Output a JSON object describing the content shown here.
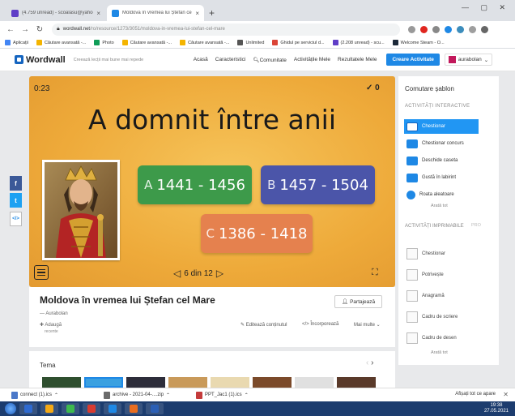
{
  "browser": {
    "tabs": [
      {
        "label": "(4.759 unread) - scoalasu@yahoo",
        "favicon_color": "#5f3ec7"
      },
      {
        "label": "Moldova în vremea lui Ștefan cel",
        "favicon_color": "#1e88e5"
      }
    ],
    "new_tab_glyph": "+",
    "window_controls": "—  ▢  ✕",
    "url_domain": "wordwall.net",
    "url_path": "/ro/resource/1273/3051/moldova-in-vremea-lui-stefan-cel-mare",
    "bookmarks": [
      {
        "label": "Aplicații",
        "color": "#4285f4"
      },
      {
        "label": "Căutare avansată -...",
        "color": "#f4b400"
      },
      {
        "label": "Photo",
        "color": "#0f9d58"
      },
      {
        "label": "Căutare avansată -...",
        "color": "#f4b400"
      },
      {
        "label": "Căutare avansată -...",
        "color": "#f4b400"
      },
      {
        "label": "Unlimited",
        "color": "#555555"
      },
      {
        "label": "Ghidul pe serviciul d...",
        "color": "#db4437"
      },
      {
        "label": "(2.208 unread) - scu...",
        "color": "#5f3ec7"
      },
      {
        "label": "Welcome Steam - O...",
        "color": "#1b2838"
      }
    ]
  },
  "header": {
    "logo": "Wordwall",
    "slogan": "Creează lecții mai bune mai repede",
    "nav": [
      "Acasă",
      "Caracteristici",
      "Comunitate",
      "Activitățile Mele",
      "Rezultatele Mele"
    ],
    "create_button": "Creare Activitate",
    "user": "aurabolan"
  },
  "game": {
    "timer": "0:23",
    "score": "0",
    "score_glyph": "✓",
    "question": "A domnit între anii",
    "answers": [
      {
        "letter": "A",
        "text": "1441 - 1456",
        "color": "#3d9a4a"
      },
      {
        "letter": "B",
        "text": "1457 - 1504",
        "color": "#4b55a9"
      },
      {
        "letter": "C",
        "text": "1386 - 1418",
        "color": "#e5814e"
      }
    ],
    "pager": "6 din 12"
  },
  "activity": {
    "title": "Moldova în vremea lui Ștefan cel Mare",
    "share_button": "Partajează",
    "author": "Aurabolan",
    "follow": "Adaugă",
    "follow_sub": "recente",
    "actions": [
      "Editează conținutul",
      "Încorporează",
      "Mai multe"
    ],
    "theme_title": "Tema"
  },
  "sidebar": {
    "heading": "Comutare șablon",
    "interactive_label": "ACTIVITĂȚI INTERACTIVE",
    "interactive_items": [
      {
        "label": "Chestionar",
        "active": true
      },
      {
        "label": "Chestionar concurs",
        "active": false
      },
      {
        "label": "Deschide caseta",
        "active": false
      },
      {
        "label": "Gustă în labirint",
        "active": false
      },
      {
        "label": "Roata aleatoare",
        "active": false
      }
    ],
    "see_all": "Arată tot",
    "printable_label": "ACTIVITĂȚI IMPRIMABILE",
    "pro_badge": "PRO",
    "printable_items": [
      "Chestionar",
      "Potrivește",
      "Anagramă",
      "Cadru de scriere",
      "Cadru de desen"
    ],
    "see_all_print": "Arată tot"
  },
  "downloads": {
    "items": [
      {
        "label": "connect (1).ics",
        "color": "#4a78c9"
      },
      {
        "label": "archive - 2021-04-....zip",
        "color": "#6b6b6b"
      },
      {
        "label": "PPT_Jac1 (1).ics",
        "color": "#c43b3b"
      }
    ],
    "show_all": "Afișați tot ce apare",
    "close_glyph": "✕"
  },
  "taskbar": {
    "apps": [
      "#2e6ad1",
      "#f4a916",
      "#3dba4e",
      "#d93b30",
      "#1e88e5",
      "#e96d1f",
      "#2b5fb5"
    ],
    "time": "19:38",
    "date": "27.05.2021"
  }
}
